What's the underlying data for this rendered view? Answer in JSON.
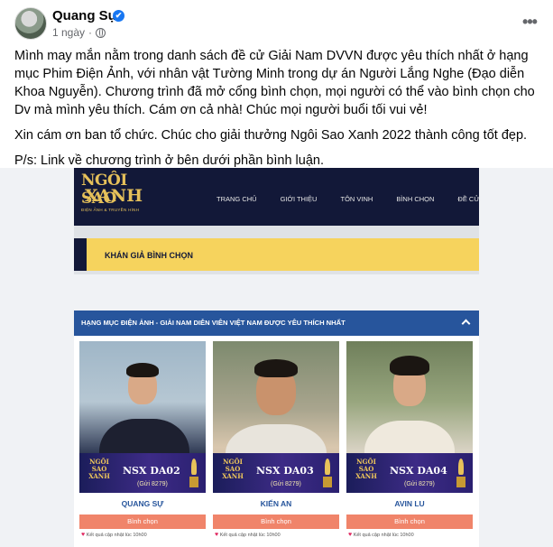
{
  "post": {
    "author": "Quang Sự",
    "time": "1 ngày",
    "verified_mark": "✔",
    "more_label": "•••",
    "paragraphs": [
      "Mình may mắn nằm trong danh sách đề cử Giải Nam DVVN được yêu thích nhất ở hạng mục Phim Điện Ảnh, với nhân vật Tường Minh trong dự án Người Lắng Nghe (Đạo diễn Khoa Nguyễn). Chương trình đã mở cổng bình chọn, mọi người có thể vào bình chọn cho Dv mà mình yêu thích. Cám ơn cả nhà! Chúc mọi người buổi tối vui vẻ!",
      "Xin cám ơn ban tổ chức. Chúc cho giải thưởng Ngôi Sao Xanh 2022 thành công tốt đẹp.",
      "P/s: Link về chương trình ở bên dưới phần bình luận."
    ],
    "icons": {
      "verified": "verified-badge-icon",
      "privacy": "globe-icon",
      "more": "more-options-icon"
    }
  },
  "site": {
    "logo_line1": "NGÔI SAO",
    "logo_line2": "XANH",
    "logo_sub": "ĐIỆN ẢNH & TRUYỀN HÌNH",
    "nav": [
      "TRANG CHỦ",
      "GIỚI THIỆU",
      "TÔN VINH",
      "BÌNH CHỌN",
      "ĐỀ CỬ"
    ],
    "banner_title": "KHÁN GIẢ BÌNH CHỌN"
  },
  "category": {
    "title": "HẠNG MỤC ĐIỆN ẢNH - GIẢI NAM DIỄN VIÊN VIỆT NAM ĐƯỢC YÊU THÍCH NHẤT"
  },
  "candidates": [
    {
      "name": "QUANG SỰ",
      "code": "NSX DA02",
      "sms": "(Gửi 8279)",
      "logo_text": "NGÔI SAO XANH",
      "vote_label": "Bình chọn",
      "update_text": "Kết quả cập nhật lúc 10h00"
    },
    {
      "name": "KIẾN AN",
      "code": "NSX DA03",
      "sms": "(Gửi 8279)",
      "logo_text": "NGÔI SAO XANH",
      "vote_label": "Bình chọn",
      "update_text": "Kết quả cập nhật lúc 10h00"
    },
    {
      "name": "AVIN LU",
      "code": "NSX DA04",
      "sms": "(Gửi 8279)",
      "logo_text": "NGÔI SAO XANH",
      "vote_label": "Bình chọn",
      "update_text": "Kết quả cập nhật lúc 10h00"
    }
  ],
  "colors": {
    "site_navy": "#121838",
    "banner_yellow": "#f6d35d",
    "category_blue": "#27559c",
    "vote_orange": "#f0846a",
    "facebook_blue": "#1877f2"
  }
}
